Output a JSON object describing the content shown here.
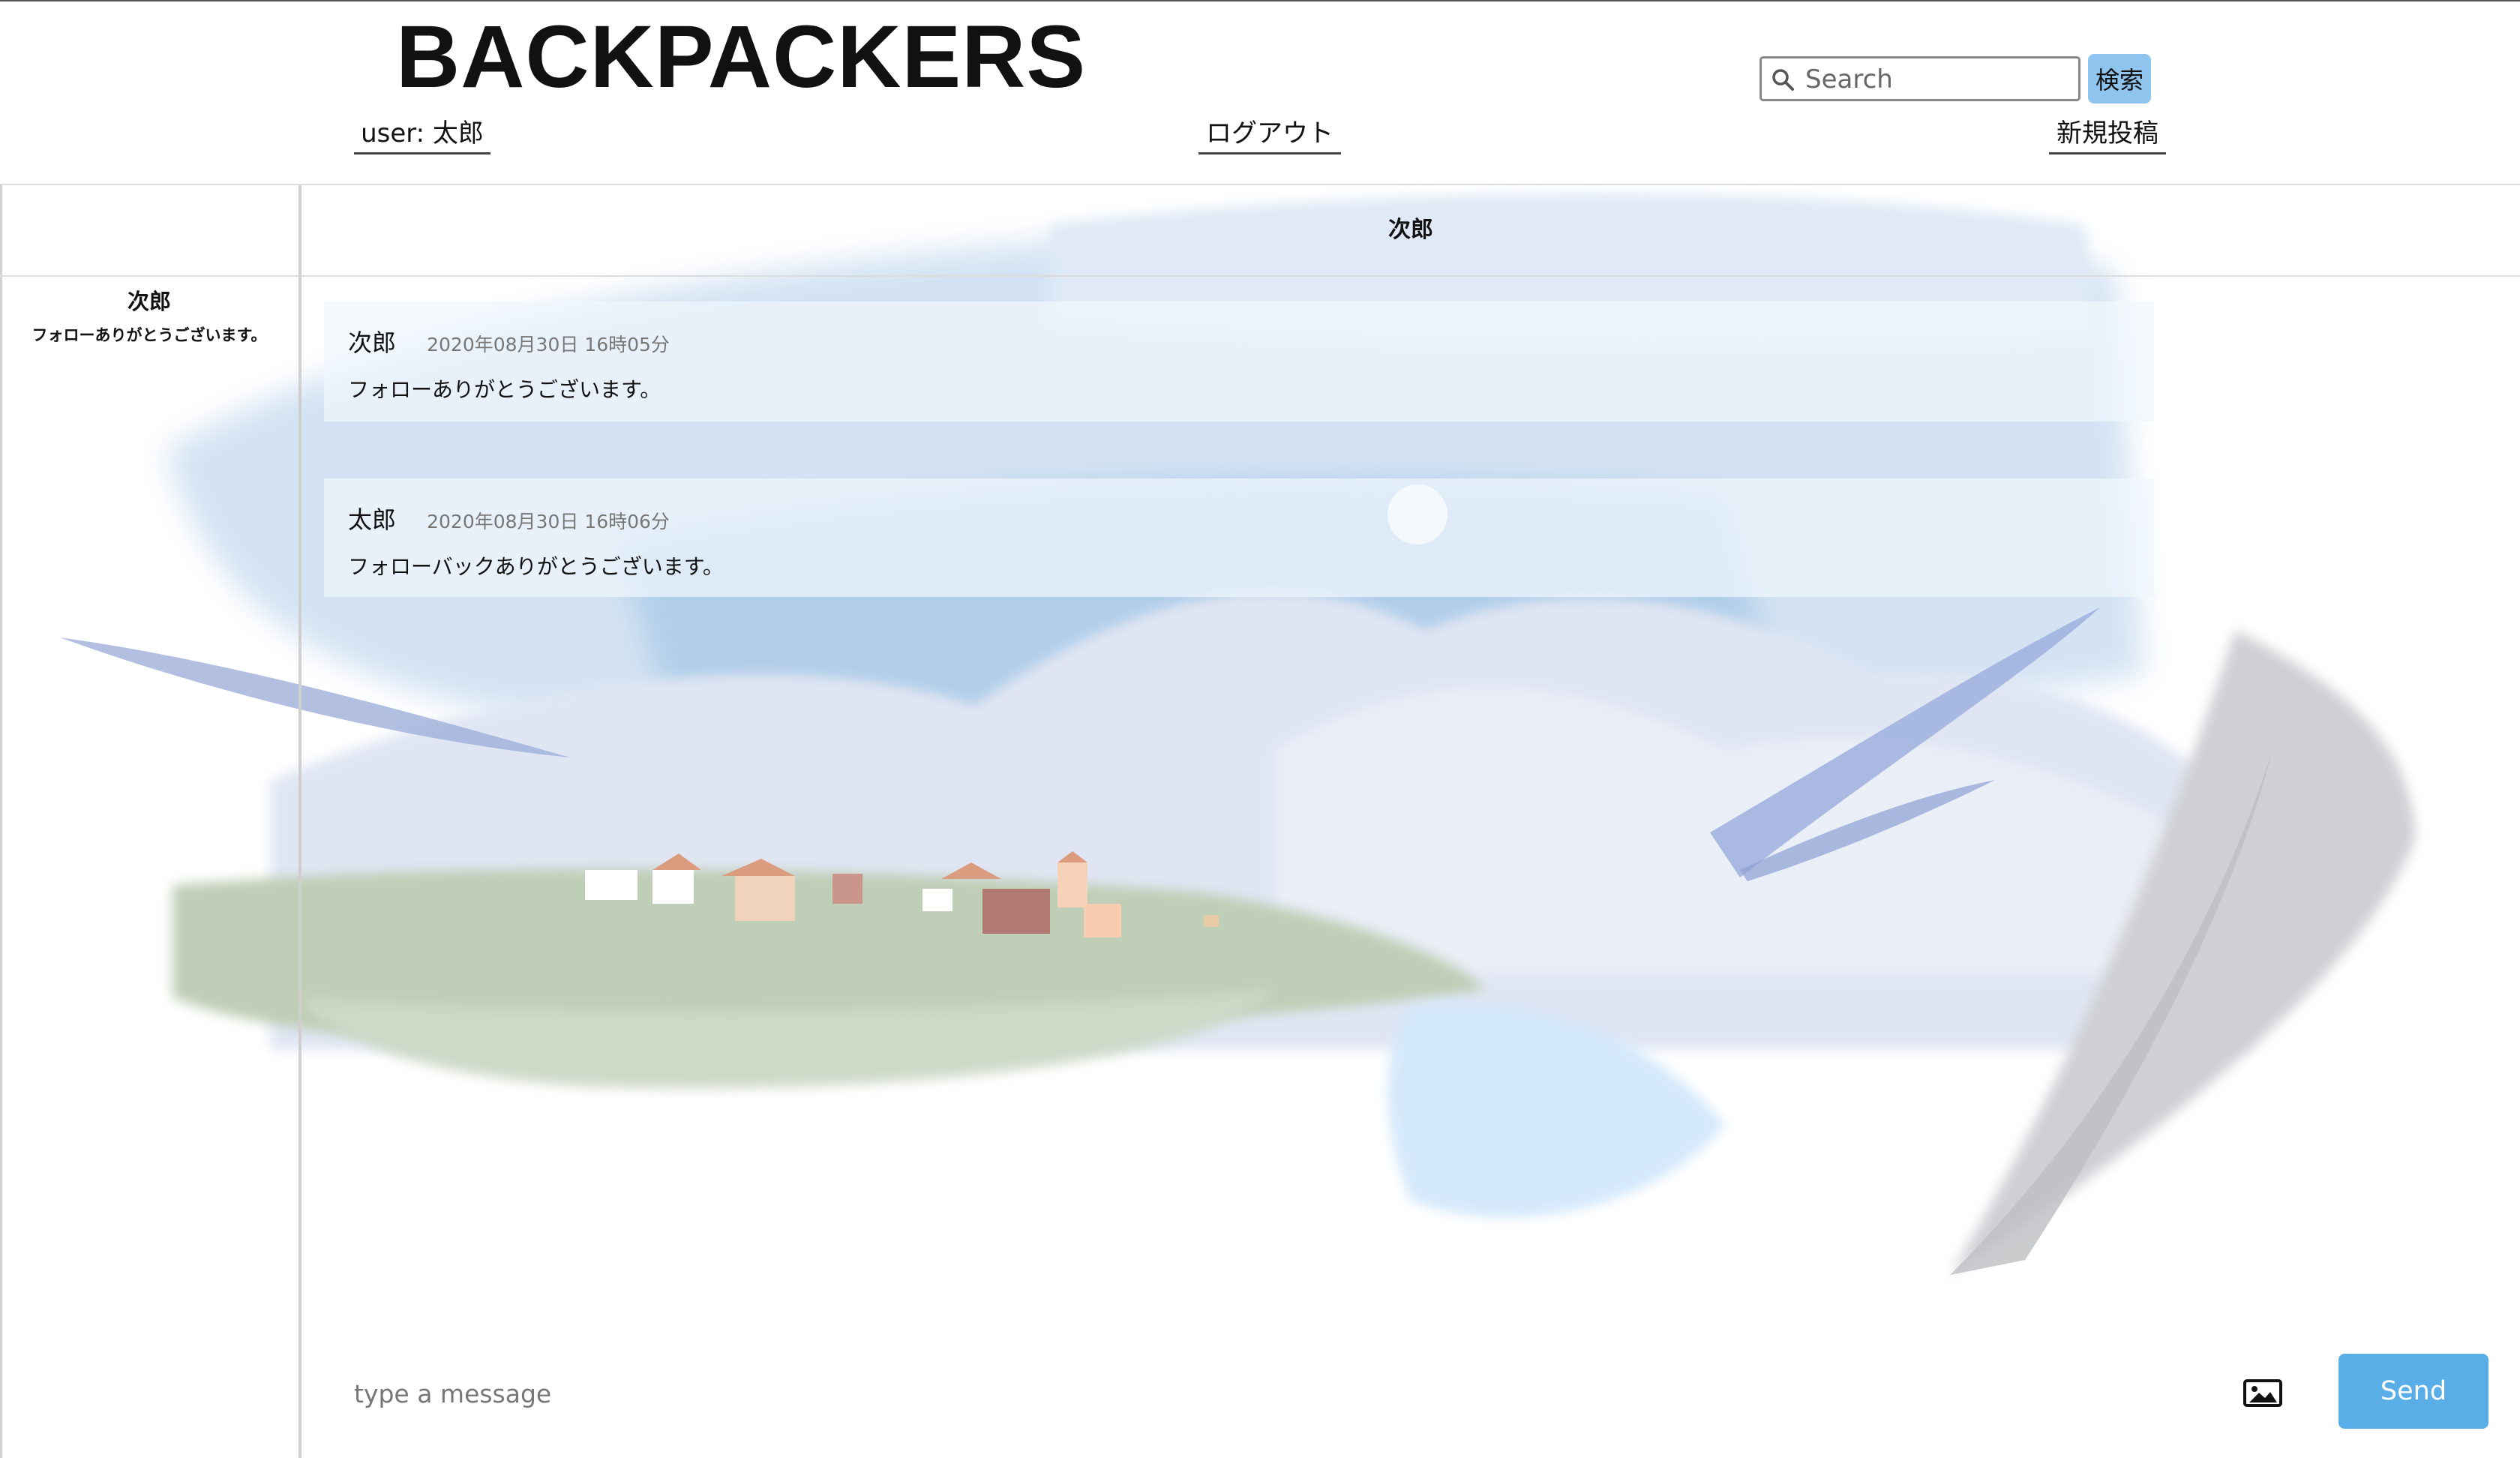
{
  "header": {
    "brand": "BACKPACKERS",
    "user_label": "user: 太郎",
    "logout_label": "ログアウト",
    "new_post_label": "新規投稿",
    "search_placeholder": "Search",
    "search_button_label": "検索"
  },
  "sidebar": {
    "conversations": [
      {
        "name": "次郎",
        "preview": "フォローありがとうございます。"
      }
    ]
  },
  "chat": {
    "partner_name": "次郎",
    "messages": [
      {
        "author": "次郎",
        "time": "2020年08月30日 16時05分",
        "text": "フォローありがとうございます。"
      },
      {
        "author": "太郎",
        "time": "2020年08月30日 16時06分",
        "text": "フォローバックありがとうございます。"
      }
    ]
  },
  "composer": {
    "placeholder": "type a message",
    "image_icon": "image-icon",
    "send_label": "Send"
  },
  "colors": {
    "send_button": "#5aaee8",
    "search_button": "#8fc4ef"
  }
}
